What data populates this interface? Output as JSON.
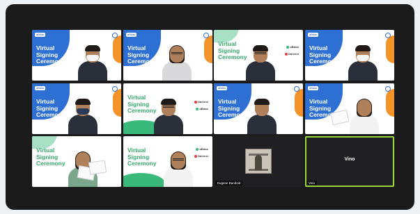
{
  "meeting": {
    "accent_active_speaker": "#9bd93a",
    "slide_title": "Virtual Signing Ceremony",
    "slide_title_lines": [
      "Virtual",
      "Signing",
      "Ceremony"
    ],
    "brand_badges": [
      "aBdas",
      "Dalensi"
    ],
    "participants": [
      {
        "name": "",
        "layout": "blue"
      },
      {
        "name": "",
        "layout": "blue"
      },
      {
        "name": "",
        "layout": "green"
      },
      {
        "name": "",
        "layout": "blue"
      },
      {
        "name": "",
        "layout": "blue"
      },
      {
        "name": "",
        "layout": "green"
      },
      {
        "name": "",
        "layout": "blue"
      },
      {
        "name": "",
        "layout": "blue"
      },
      {
        "name": "",
        "layout": "green"
      },
      {
        "name": "",
        "layout": "green"
      },
      {
        "name": "Eugene Bandoid",
        "layout": "camera"
      },
      {
        "name": "Vino",
        "layout": "name-only"
      }
    ],
    "active_speaker_label": "Vino",
    "active_speaker_tag": "Vino"
  }
}
